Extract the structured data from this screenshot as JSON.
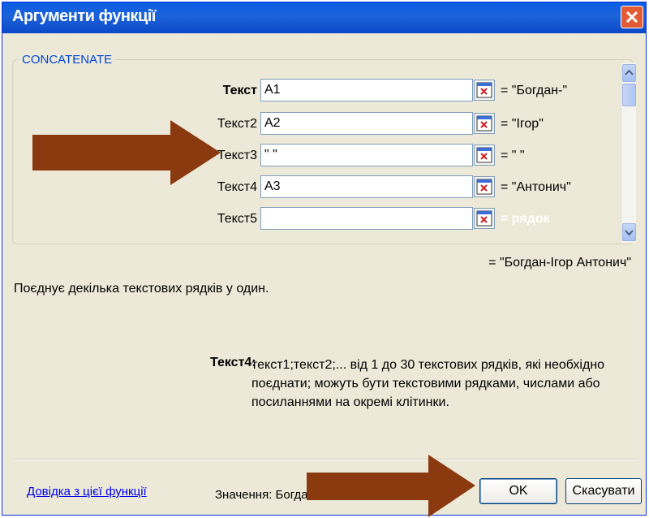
{
  "window": {
    "title": "Аргументи функції"
  },
  "group": {
    "label": "CONCATENATE"
  },
  "args": [
    {
      "label": "Текст",
      "value": "A1",
      "result": "= \"Богдан-\"",
      "bold": true
    },
    {
      "label": "Текст2",
      "value": "A2",
      "result": "= \"Ігор\""
    },
    {
      "label": "Текст3",
      "value": "\" \"",
      "result": "= \" \""
    },
    {
      "label": "Текст4",
      "value": "A3",
      "result": "= \"Антонич\""
    },
    {
      "label": "Текст5",
      "value": "",
      "result": "= рядок"
    }
  ],
  "formula_result": "= \"Богдан-Ігор Антонич\"",
  "description": "Поєднує декілька текстових рядків у один.",
  "help": {
    "name": "Текст4:",
    "text": "текст1;текст2;... від 1 до 30 текстових рядків, які необхідно поєднати; можуть бути текстовими рядками, числами або посиланнями на окремі клітинки."
  },
  "footer": {
    "help_link": "Довідка з цієї функції",
    "value_label": "Значення: Богда",
    "ok_label": "OK",
    "cancel_label": "Скасувати"
  },
  "colors": {
    "arrow": "#8b3a0f",
    "title_bar": "#0a5ee6",
    "accent": "#0046d5"
  }
}
